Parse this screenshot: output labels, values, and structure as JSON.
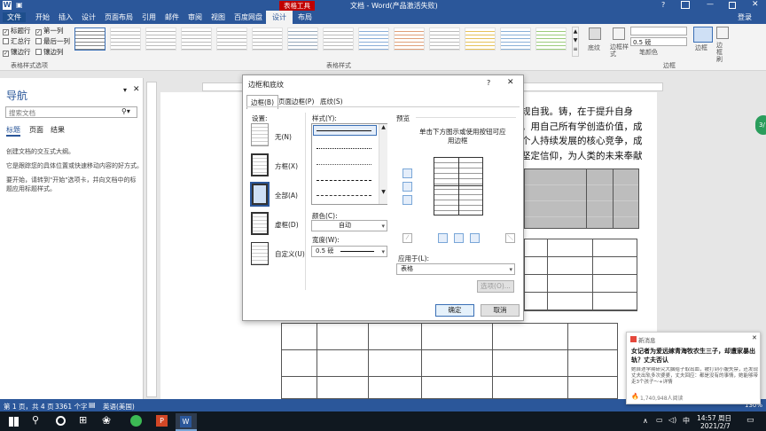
{
  "titlebar": {
    "tool_context": "表格工具",
    "title": "文档 - Word(产品激活失败)",
    "help": "?"
  },
  "tabs": [
    "文件",
    "开始",
    "插入",
    "设计",
    "页面布局",
    "引用",
    "邮件",
    "审阅",
    "视图",
    "百度网盘",
    "设计",
    "布局"
  ],
  "account": "登录",
  "ribbon": {
    "checks": [
      {
        "label": "标题行",
        "checked": true
      },
      {
        "label": "第一列",
        "checked": true
      },
      {
        "label": "汇总行",
        "checked": false
      },
      {
        "label": "最后一列",
        "checked": false
      },
      {
        "label": "镶边行",
        "checked": true
      },
      {
        "label": "镶边列",
        "checked": false
      }
    ],
    "group1": "表格样式选项",
    "group2": "表格样式",
    "group3": "边框",
    "shading": "底纹",
    "border_styles": "边框样式",
    "pen_weight": "0.5 磅",
    "pen_color": "笔颜色",
    "borders": "边框",
    "border_painter": "边框刷"
  },
  "nav": {
    "title": "导航",
    "search_placeholder": "搜索文档",
    "tabs": [
      "标题",
      "页面",
      "结果"
    ],
    "line1": "创建文档的交互式大纲。",
    "line2": "它是跟踪您的具体位置或快速移动内容的好方式。",
    "line3": "要开始，请转到\"开始\"选项卡，并向文档中的标题应用标题样式。"
  },
  "doc_lines": [
    "规自我。铸，在于提升自身",
    "。用自己所有学创造价值，成",
    "个人持续发展的核心竞争，成",
    "坚定信仰，为人类的未来奉献"
  ],
  "dialog": {
    "title": "边框和底纹",
    "help": "?",
    "tabs": [
      "边框(B)",
      "页面边框(P)",
      "底纹(S)"
    ],
    "setting_label": "设置:",
    "settings": [
      "无(N)",
      "方框(X)",
      "全部(A)",
      "虚框(D)",
      "自定义(U)"
    ],
    "style_label": "样式(Y):",
    "color_label": "颜色(C):",
    "color_value": "自动",
    "width_label": "宽度(W):",
    "width_value": "0.5 磅",
    "preview_label": "预览",
    "preview_hint1": "单击下方图示或使用按钮可应",
    "preview_hint2": "用边框",
    "apply_label": "应用于(L):",
    "apply_value": "表格",
    "options": "选项(O)...",
    "ok": "确定",
    "cancel": "取消"
  },
  "status": {
    "page": "第 1 页，共 4 页",
    "words": "3361 个字",
    "lang": "英语(美国)",
    "zoom": "130%"
  },
  "taskbar": {
    "time": "14:57 周日",
    "date": "2021/2/7",
    "ime": "中"
  },
  "toast": {
    "header": "新消息",
    "headline": "女记者为爱远嫁青海牧农生三子，却遭家暴出轨？丈夫否认",
    "body": "她自述学期研究大脑给子取出血，被打到小腹失禁，还发现丈夫出轨多次婆婆，丈夫回应：都是没有的事情，她能够带走3个孩子～+详情",
    "reads": "1,740,948人阅读"
  },
  "side_badge": "3/"
}
